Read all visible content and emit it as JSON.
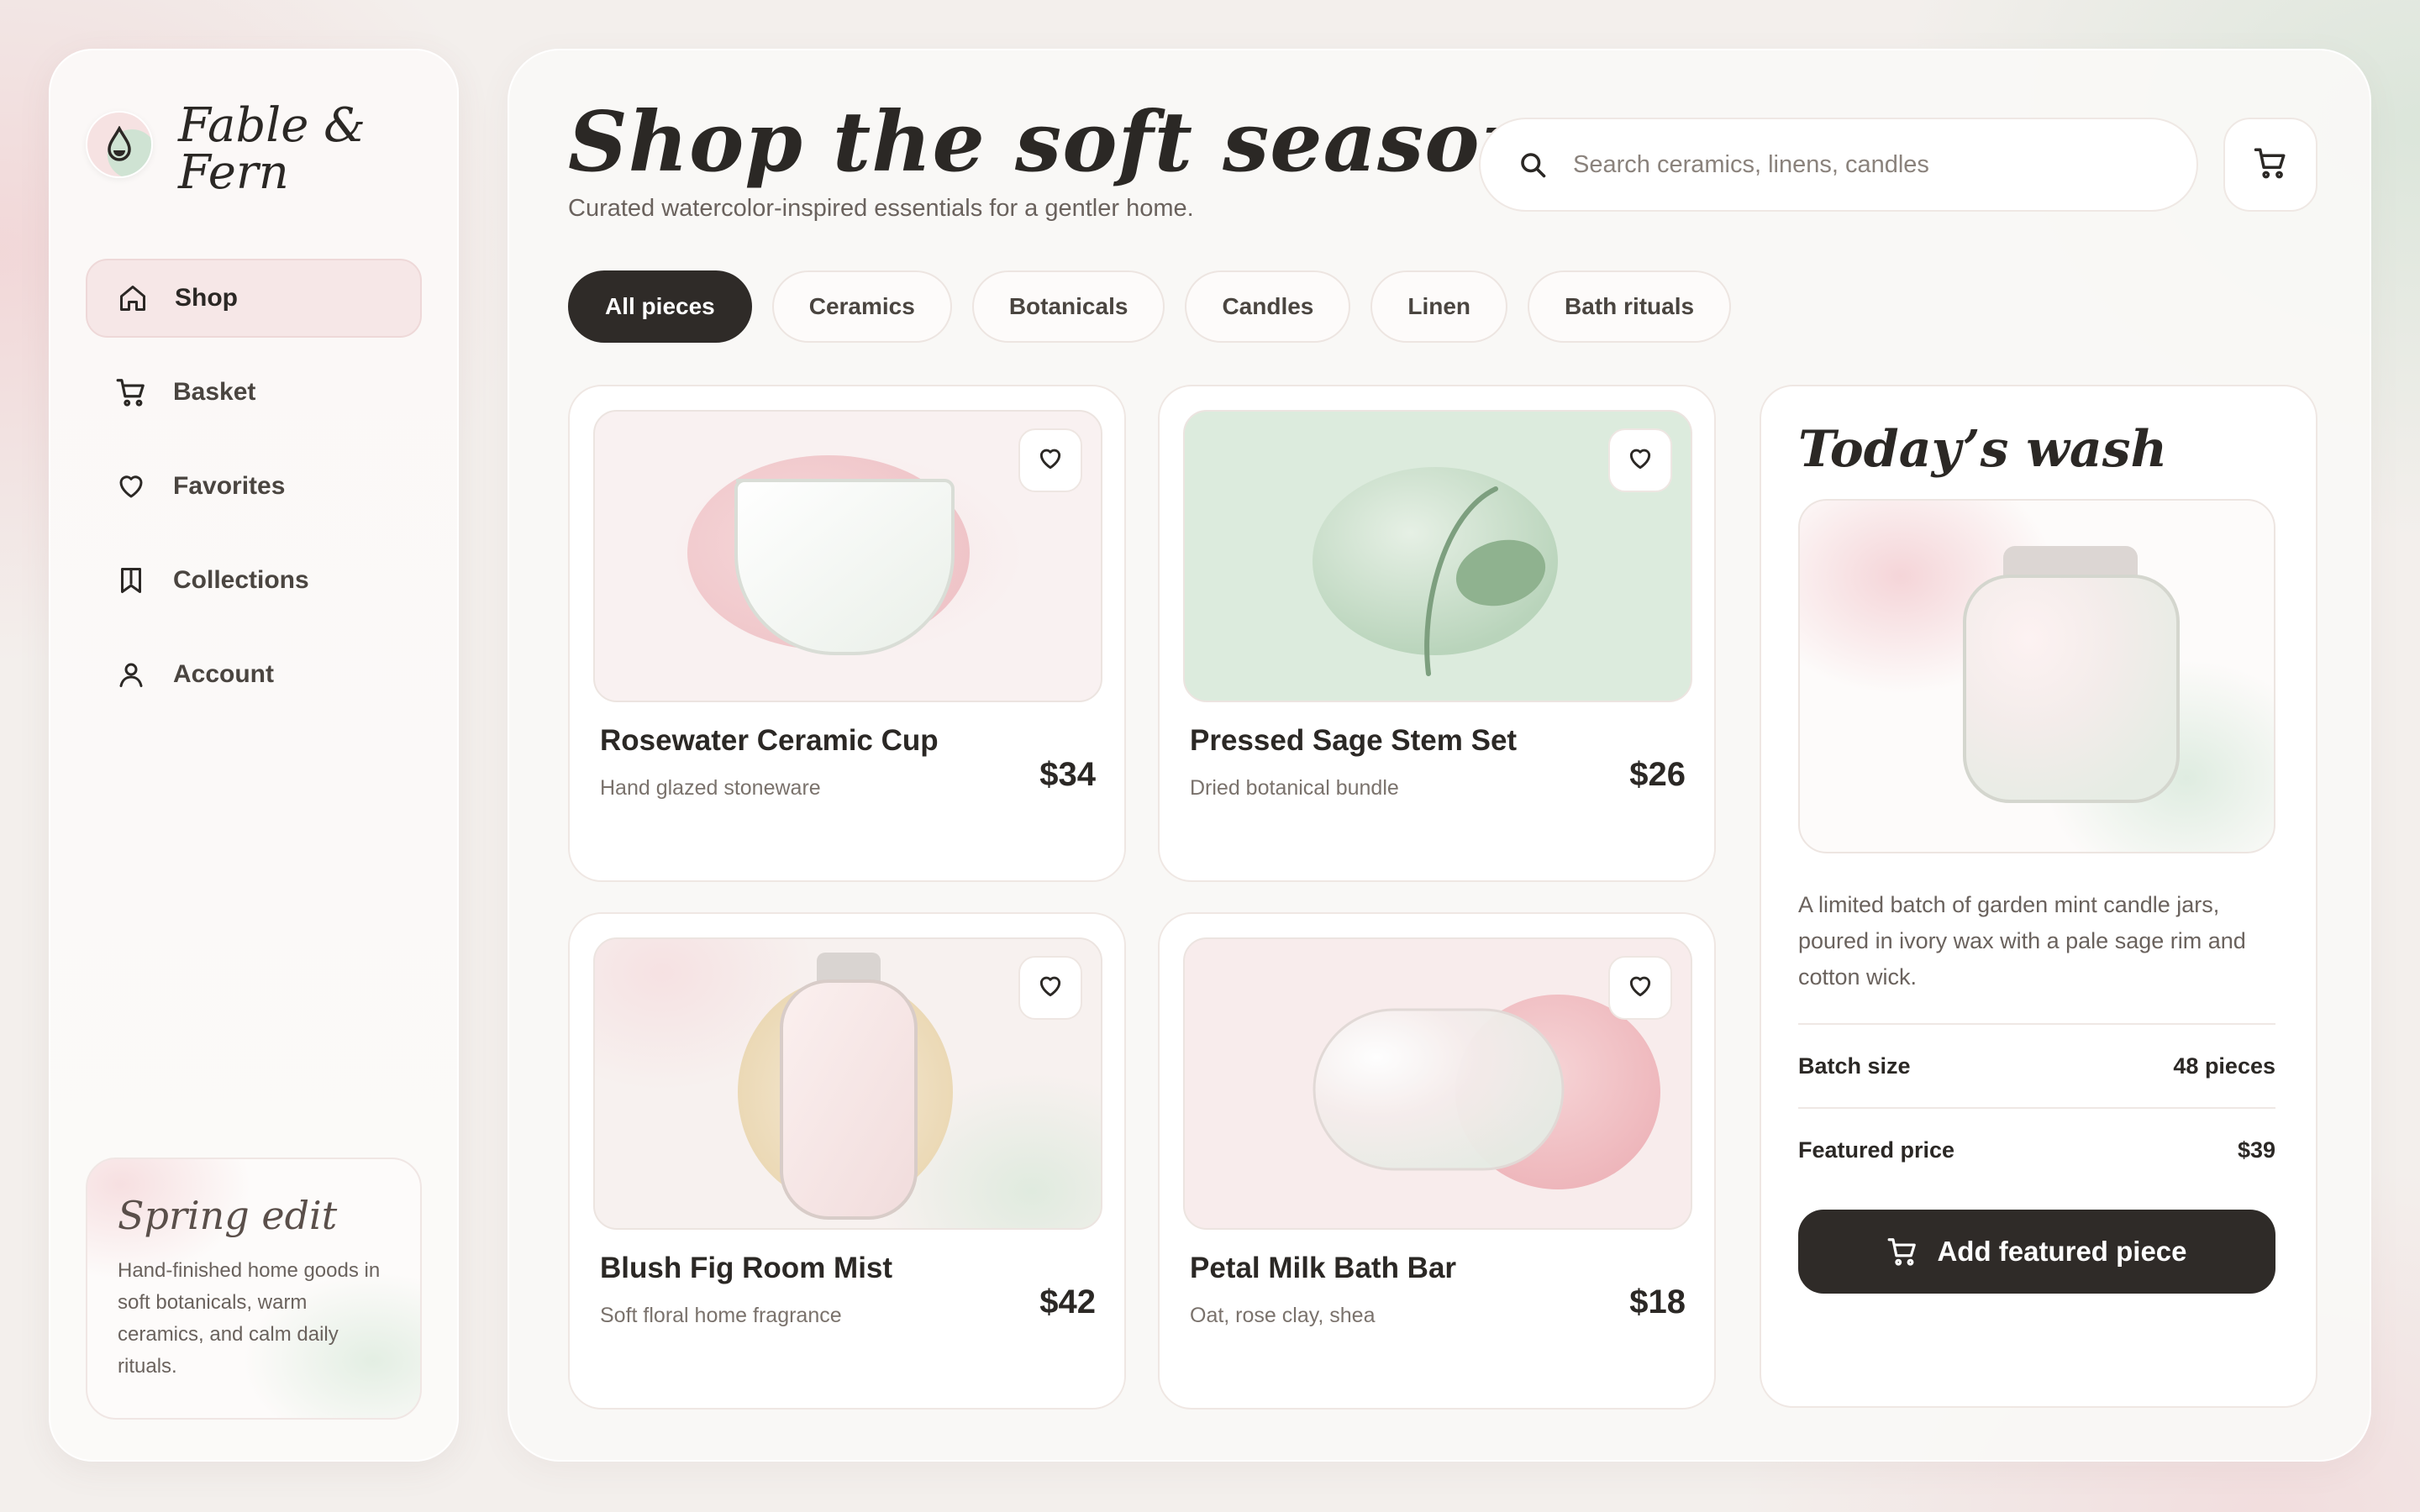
{
  "brand": {
    "name": "Fable & Fern",
    "logo_icon": "droplet-icon"
  },
  "nav": [
    {
      "label": "Shop",
      "icon": "home-icon",
      "active": true
    },
    {
      "label": "Basket",
      "icon": "cart-icon"
    },
    {
      "label": "Favorites",
      "icon": "heart-icon"
    },
    {
      "label": "Collections",
      "icon": "bookmark-icon"
    },
    {
      "label": "Account",
      "icon": "user-icon"
    }
  ],
  "promo": {
    "title": "Spring edit",
    "text": "Hand-finished home goods in soft botanicals, warm ceramics, and calm daily rituals."
  },
  "header": {
    "title": "Shop the soft season",
    "subtitle": "Curated watercolor-inspired essentials for a gentler home."
  },
  "search": {
    "placeholder": "Search ceramics, linens, candles",
    "value": ""
  },
  "filters": [
    "All pieces",
    "Ceramics",
    "Botanicals",
    "Candles",
    "Linen",
    "Bath rituals"
  ],
  "active_filter": "All pieces",
  "products": [
    {
      "name": "Rosewater Ceramic Cup",
      "description": "Hand glazed stoneware",
      "price": "$34"
    },
    {
      "name": "Pressed Sage Stem Set",
      "description": "Dried botanical bundle",
      "price": "$26"
    },
    {
      "name": "Blush Fig Room Mist",
      "description": "Soft floral home fragrance",
      "price": "$42"
    },
    {
      "name": "Petal Milk Bath Bar",
      "description": "Oat, rose clay, shea",
      "price": "$18"
    }
  ],
  "featured": {
    "title": "Today’s wash",
    "description": "A limited batch of garden mint candle jars, poured in ivory wax with a pale sage rim and cotton wick.",
    "batch_label": "Batch size",
    "batch_value": "48 pieces",
    "price_label": "Featured price",
    "price_value": "$39",
    "cta": "Add featured piece"
  },
  "colors": {
    "accent_dark": "#2f2b28",
    "blush": "#f2c8cd",
    "sage": "#cfe3d3",
    "background": "#f3efec"
  }
}
